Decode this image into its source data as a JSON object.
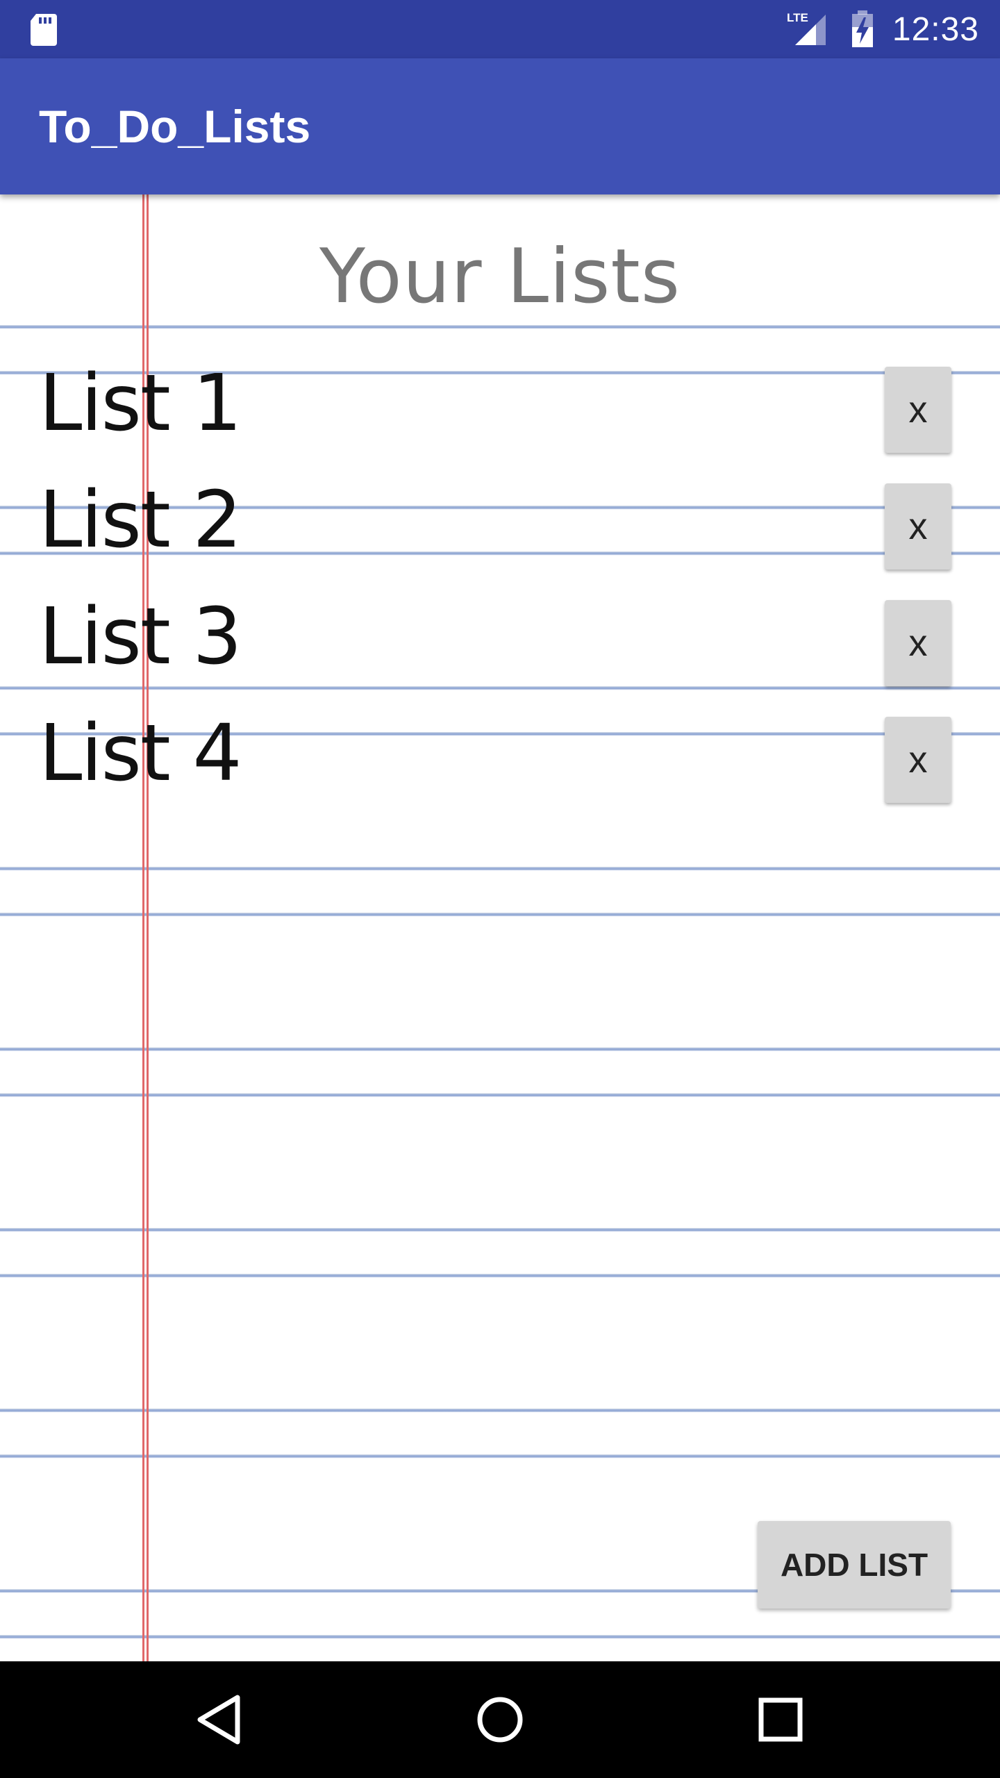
{
  "status_bar": {
    "time": "12:33",
    "icons": [
      "sd-card-icon",
      "lte-signal-icon",
      "battery-charging-icon"
    ],
    "network_label": "LTE"
  },
  "app_bar": {
    "title": "To_Do_Lists",
    "color": "#3f51b5"
  },
  "main": {
    "heading": "Your Lists",
    "lists": [
      {
        "name": "List 1",
        "delete_label": "x"
      },
      {
        "name": "List 2",
        "delete_label": "x"
      },
      {
        "name": "List 3",
        "delete_label": "x"
      },
      {
        "name": "List 4",
        "delete_label": "x"
      }
    ],
    "add_button_label": "ADD LIST"
  },
  "nav_bar": {
    "icons": [
      "back-icon",
      "home-icon",
      "recents-icon"
    ]
  },
  "colors": {
    "status_bar": "#303f9f",
    "app_bar": "#3f51b5",
    "paper_line": "#8da4d2",
    "margin_line": "#e0686a"
  }
}
